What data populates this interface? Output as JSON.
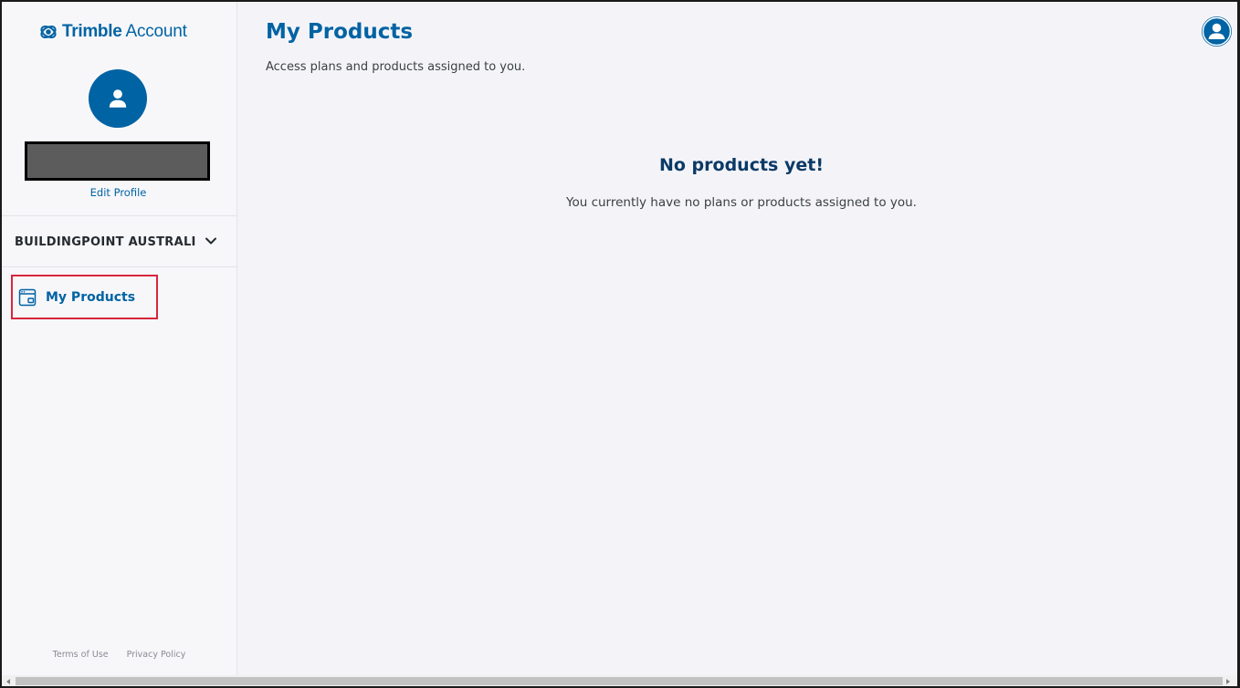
{
  "brand": {
    "name": "Trimble",
    "product": "Account",
    "color": "#0063a3"
  },
  "sidebar": {
    "edit_profile": "Edit Profile",
    "organization": "BUILDINGPOINT AUSTRALI...",
    "nav": [
      {
        "label": "My Products",
        "icon": "products-window-icon",
        "active": true
      }
    ],
    "footer": {
      "terms": "Terms of Use",
      "privacy": "Privacy Policy"
    }
  },
  "main": {
    "title": "My Products",
    "subtitle": "Access plans and products assigned to you.",
    "empty_state": {
      "title": "No products yet!",
      "message": "You currently have no plans or products assigned to you."
    }
  },
  "colors": {
    "accent": "#0063a3",
    "highlight_border": "#d7263d",
    "heading_dark": "#0b3a66"
  }
}
